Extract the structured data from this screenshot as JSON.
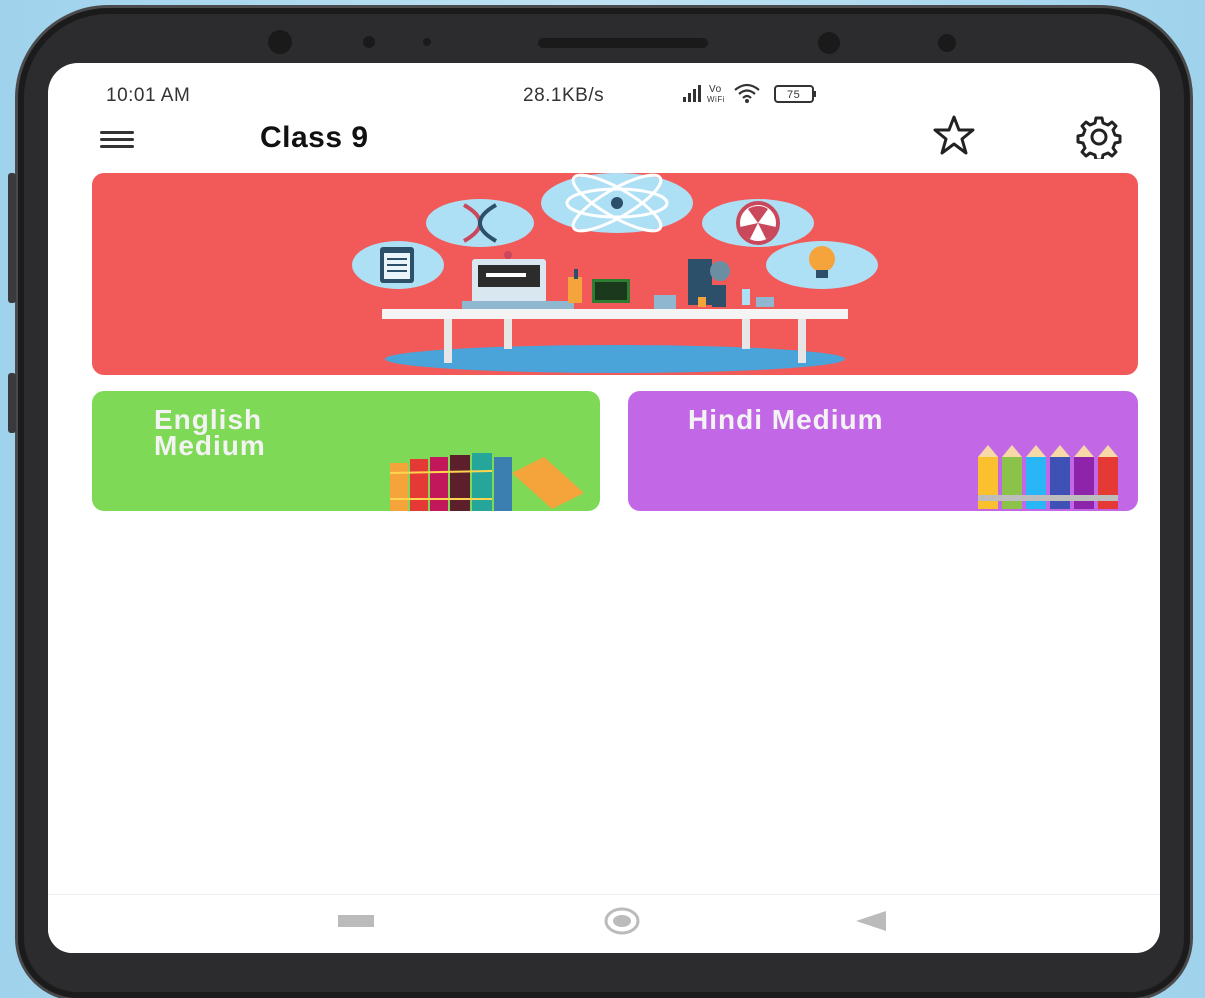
{
  "status_bar": {
    "time": "10:01 AM",
    "network_rate": "28.1KB/s",
    "signal_icon": "signal-bars-icon",
    "volte_label": "Vo",
    "wifi_small_label": "WiFi",
    "wifi_icon": "wifi-icon",
    "battery_level": "75"
  },
  "app_bar": {
    "title": "Class 9",
    "menu_icon": "hamburger-menu-icon",
    "favorite_icon": "star-icon",
    "settings_icon": "gear-icon"
  },
  "banner": {
    "image": "science-lab-illustration",
    "color": "#f25a5a"
  },
  "cards": [
    {
      "label": "English\nMedium",
      "color": "#7ed957",
      "image": "books-icon"
    },
    {
      "label": "Hindi Medium",
      "color": "#c268e6",
      "image": "pencils-icon"
    }
  ],
  "nav_bar": {
    "recents": "recents-square-icon",
    "home": "home-circle-icon",
    "back": "back-triangle-icon"
  }
}
